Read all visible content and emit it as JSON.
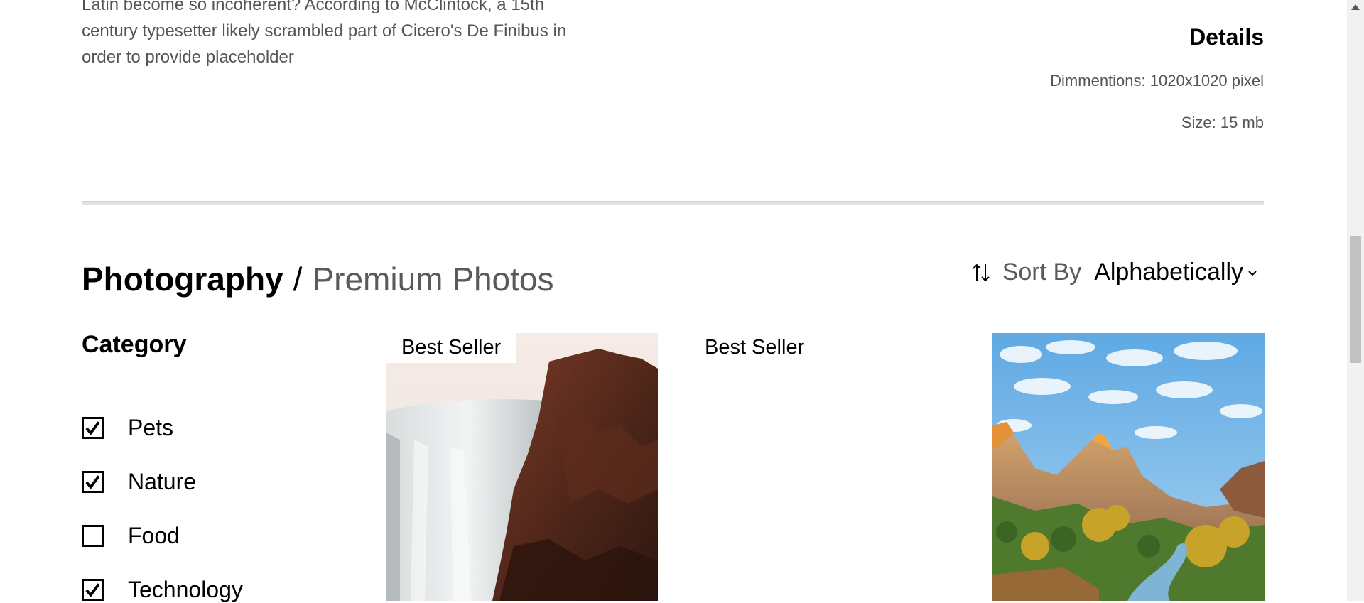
{
  "description": {
    "text_lines": [
      "Latin become so incoherent? According to McClintock, a 15th",
      "century typesetter likely scrambled part of Cicero's De Finibus in",
      "order to provide placeholder"
    ]
  },
  "details": {
    "title": "Details",
    "dimensions": "Dimmentions: 1020x1020 pixel",
    "size": "Size: 15 mb"
  },
  "breadcrumb": {
    "main": "Photography",
    "separator": "/",
    "sub": "Premium Photos"
  },
  "sort": {
    "icon": "sort-arrows-icon",
    "label": "Sort By",
    "value": "Alphabetically"
  },
  "category": {
    "title": "Category",
    "items": [
      {
        "label": "Pets",
        "checked": true
      },
      {
        "label": "Nature",
        "checked": true
      },
      {
        "label": "Food",
        "checked": false
      },
      {
        "label": "Technology",
        "checked": true
      }
    ]
  },
  "products": [
    {
      "badge": "Best Seller",
      "image": "waterfall-cliff-photo"
    },
    {
      "badge": "Best Seller",
      "image": "blank-photo"
    },
    {
      "badge": "",
      "image": "canyon-river-photo"
    }
  ]
}
